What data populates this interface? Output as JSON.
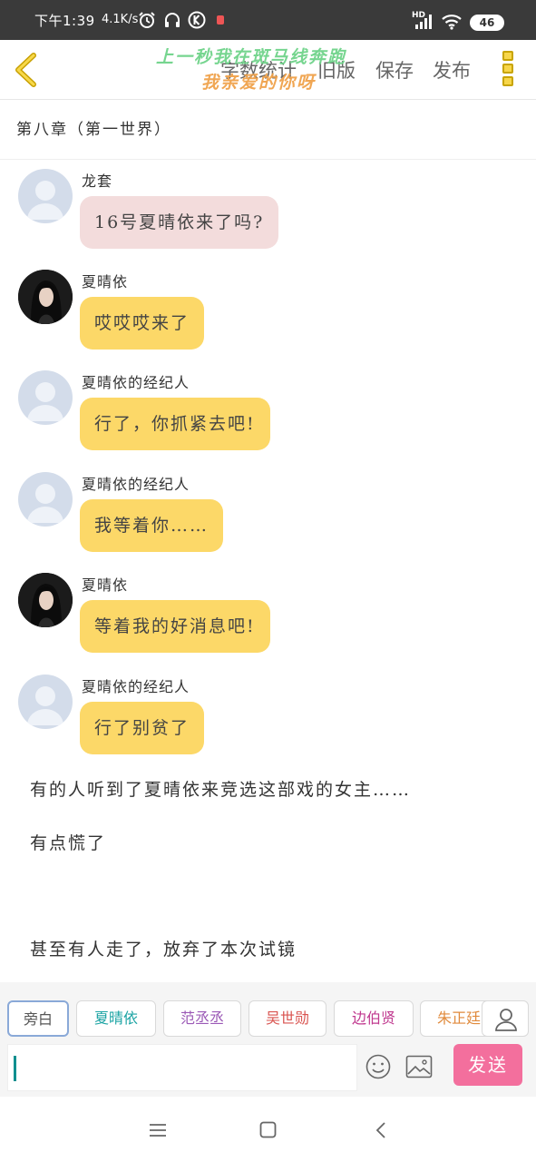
{
  "status_bar": {
    "time": "下午1:39",
    "net_speed": "4.1K/s",
    "hd_label": "HD",
    "battery": "46",
    "icons": [
      "alarm-icon",
      "headphones-icon",
      "k-badge-icon",
      "notification-icon",
      "signal-icon",
      "wifi-icon",
      "battery-icon"
    ]
  },
  "toolbar": {
    "back_icon": "chevron-left-icon",
    "items": [
      "字数统计",
      "旧版",
      "保存",
      "发布"
    ],
    "more_icon": "more-vertical-icon",
    "watermark_line1": "上一秒我在斑马线奔跑",
    "watermark_line2": "我亲爱的你呀"
  },
  "chapter": {
    "title": "第八章（第一世界）"
  },
  "messages": [
    {
      "name": "龙套",
      "text": "16号夏晴依来了吗?",
      "avatar": "default",
      "style": "pink"
    },
    {
      "name": "夏晴依",
      "text": "哎哎哎来了",
      "avatar": "photo",
      "style": "yellow"
    },
    {
      "name": "夏晴依的经纪人",
      "text": "行了，你抓紧去吧!",
      "avatar": "default",
      "style": "yellow"
    },
    {
      "name": "夏晴依的经纪人",
      "text": "我等着你……",
      "avatar": "default",
      "style": "yellow"
    },
    {
      "name": "夏晴依",
      "text": "等着我的好消息吧!",
      "avatar": "photo",
      "style": "yellow"
    },
    {
      "name": "夏晴依的经纪人",
      "text": "行了别贫了",
      "avatar": "default",
      "style": "yellow"
    }
  ],
  "narration": [
    "有的人听到了夏晴依来竞选这部戏的女主……",
    "有点慌了",
    "甚至有人走了，放弃了本次试镜"
  ],
  "roles": [
    {
      "label": "旁白",
      "color": "#555555"
    },
    {
      "label": "夏晴依",
      "color": "#1aa3a3"
    },
    {
      "label": "范丞丞",
      "color": "#9b59b6"
    },
    {
      "label": "吴世勋",
      "color": "#d9534f"
    },
    {
      "label": "边伯贤",
      "color": "#c0398f"
    },
    {
      "label": "朱正廷",
      "color": "#e08a3c"
    }
  ],
  "input": {
    "placeholder": "",
    "send_label": "发送"
  },
  "nav": {
    "icons": [
      "menu-icon",
      "home-square-icon",
      "back-triangle-icon"
    ]
  }
}
